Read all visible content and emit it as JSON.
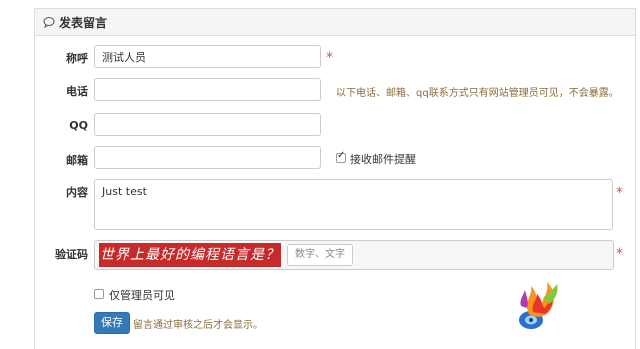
{
  "panel": {
    "title": "发表留言"
  },
  "form": {
    "nickname": {
      "label": "称呼",
      "value": "测试人员",
      "required_mark": "*"
    },
    "phone": {
      "label": "电话",
      "value": "",
      "hint": "以下电话、邮箱、qq联系方式只有网站管理员可见，不会暴露。"
    },
    "qq": {
      "label": "QQ",
      "value": ""
    },
    "email": {
      "label": "邮箱",
      "value": "",
      "notify_label": "接收邮件提醒",
      "notify_checked": true
    },
    "content": {
      "label": "内容",
      "value": "Just test",
      "required_mark": "*"
    },
    "captcha": {
      "label": "验证码",
      "question": "世界上最好的编程语言是？",
      "placeholder": "数字、文字",
      "required_mark": "*"
    },
    "admin_only": {
      "label": "仅管理员可见",
      "checked": false
    },
    "submit": {
      "label": "保存",
      "hint": "留言通过审核之后才会显示。"
    }
  },
  "colors": {
    "primary": "#337ab7",
    "required": "#d9534f",
    "hint": "#8a6d3b",
    "captcha_bg": "#c62a2a"
  },
  "icons": {
    "heading": "chat-bubble-icon",
    "logo": "flame-disc-logo"
  }
}
